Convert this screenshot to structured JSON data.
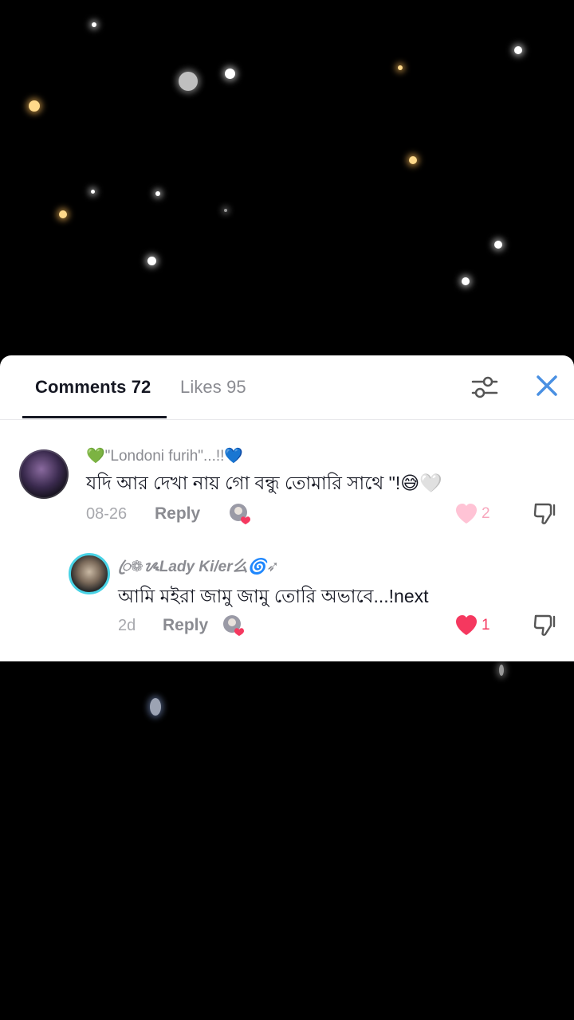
{
  "tabs": {
    "comments_label": "Comments 72",
    "likes_label": "Likes 95"
  },
  "icons": {
    "filter": "filter-sliders-icon",
    "close": "close-icon",
    "like": "heart-icon",
    "dislike": "thumbs-down-icon",
    "creator": "creator-liked-badge-icon"
  },
  "colors": {
    "accent_pink": "#f5385f",
    "light_pink": "#ffc3d5",
    "close_blue": "#4a90e2",
    "text_primary": "#161823",
    "text_secondary": "#8a8b91",
    "avatar_ring": "#49d3e6"
  },
  "comments": [
    {
      "username": "💚\"Londoni furih\"...!!💙",
      "text": "যদি আর দেখা নায় গো বন্ধু তোমারি সাথে \"!😅🤍",
      "date": "08-26",
      "reply_label": "Reply",
      "likes": "2",
      "liked": false
    },
    {
      "username": "ꦿ❁ᝰLady Ki/er么🌀➶",
      "text": "আমি মইরা জামু জামু তোরি অভাবে...!next",
      "date": "2d",
      "reply_label": "Reply",
      "likes": "1",
      "liked": true
    }
  ]
}
